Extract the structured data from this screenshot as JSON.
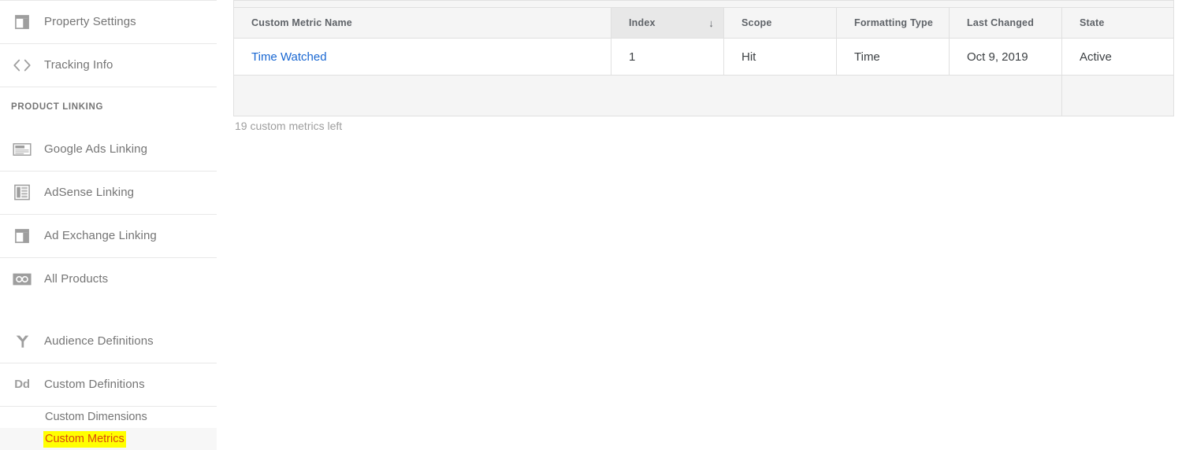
{
  "sidebar": {
    "items": [
      {
        "id": "property-settings",
        "label": "Property Settings",
        "icon": "property-settings-icon"
      },
      {
        "id": "tracking-info",
        "label": "Tracking Info",
        "icon": "code-brackets-icon"
      }
    ],
    "section_product_linking": {
      "title": "PRODUCT LINKING",
      "items": [
        {
          "id": "google-ads-linking",
          "label": "Google Ads Linking",
          "icon": "google-ads-icon"
        },
        {
          "id": "adsense-linking",
          "label": "AdSense Linking",
          "icon": "adsense-icon"
        },
        {
          "id": "ad-exchange-linking",
          "label": "Ad Exchange Linking",
          "icon": "ad-exchange-icon"
        },
        {
          "id": "all-products",
          "label": "All Products",
          "icon": "all-products-link-icon"
        }
      ]
    },
    "items_lower": [
      {
        "id": "audience-definitions",
        "label": "Audience Definitions",
        "icon": "audience-fork-icon"
      },
      {
        "id": "custom-definitions",
        "label": "Custom Definitions",
        "icon": "dd-icon",
        "icon_text": "Dd"
      }
    ],
    "sub_items": [
      {
        "id": "custom-dimensions",
        "label": "Custom Dimensions",
        "selected": false
      },
      {
        "id": "custom-metrics",
        "label": "Custom Metrics",
        "selected": true
      }
    ]
  },
  "table": {
    "columns": [
      {
        "key": "name",
        "label": "Custom Metric Name",
        "sorted": false
      },
      {
        "key": "index",
        "label": "Index",
        "sorted": true,
        "sort_direction": "descending",
        "sort_glyph": "↓"
      },
      {
        "key": "scope",
        "label": "Scope",
        "sorted": false
      },
      {
        "key": "formatting_type",
        "label": "Formatting Type",
        "sorted": false
      },
      {
        "key": "last_changed",
        "label": "Last Changed",
        "sorted": false
      },
      {
        "key": "state",
        "label": "State",
        "sorted": false
      }
    ],
    "rows": [
      {
        "name": "Time Watched",
        "name_is_link": true,
        "index": "1",
        "scope": "Hit",
        "formatting_type": "Time",
        "last_changed": "Oct 9, 2019",
        "state": "Active"
      }
    ],
    "caption": "19 custom metrics left"
  },
  "colors": {
    "link": "#1967d2",
    "highlight_bg": "#ffff00",
    "highlight_text": "#d9480f",
    "header_bg": "#f5f5f5",
    "sorted_header_bg": "#e8e8e8",
    "border": "#e0e0e0",
    "text_muted": "#757575"
  }
}
